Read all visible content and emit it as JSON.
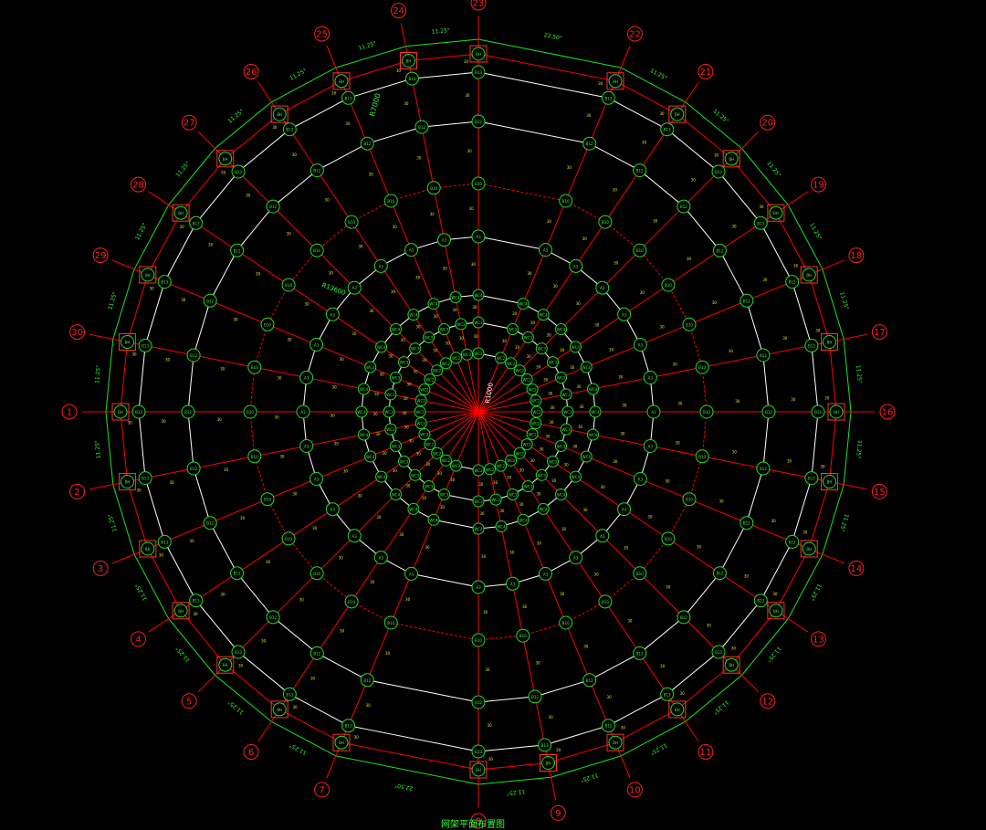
{
  "colors": {
    "background": "#000000",
    "grid_line": "#ff0000",
    "axis_bubble": "#ff2020",
    "ring_white": "#ffffff",
    "boundary_green": "#19e619",
    "node_green": "#22dd22",
    "text_green": "#33ff33",
    "text_yellow": "#e6e633",
    "support_box": "#ff3030"
  },
  "axis_labels": [
    "1",
    "2",
    "3",
    "4",
    "5",
    "6",
    "7",
    "8",
    "9",
    "10",
    "11",
    "12",
    "13",
    "14",
    "15",
    "16",
    "17",
    "18",
    "19",
    "20",
    "21",
    "22",
    "23",
    "24",
    "25",
    "26",
    "27",
    "28",
    "29",
    "30"
  ],
  "segment_angles": [
    "11.25°",
    "11.25°",
    "11.25°",
    "11.25°",
    "11.25°",
    "11.25°",
    "22.50°",
    "11.25°",
    "11.25°",
    "11.25°",
    "11.25°",
    "11.25°",
    "11.25°",
    "11.25°",
    "11.25°",
    "11.25°",
    "11.25°",
    "11.25°",
    "11.25°",
    "11.25°",
    "11.25°",
    "22.50°",
    "11.25°",
    "11.25°",
    "11.25°",
    "11.25°",
    "11.25°",
    "11.25°",
    "11.25°",
    "11.25°"
  ],
  "ring_labels": {
    "r1": "WC2",
    "r2": "WC3",
    "r3": "WC4",
    "r4": "A3",
    "r5": "B10",
    "r6": "B12",
    "r7": "B13",
    "r8": "BH"
  },
  "member_labels": {
    "radial": "30",
    "hoop": "38"
  },
  "dimension_labels": {
    "outer": "R7000",
    "middle": "R13600",
    "inner": "R1000"
  },
  "caption": "网架平面布置图"
}
